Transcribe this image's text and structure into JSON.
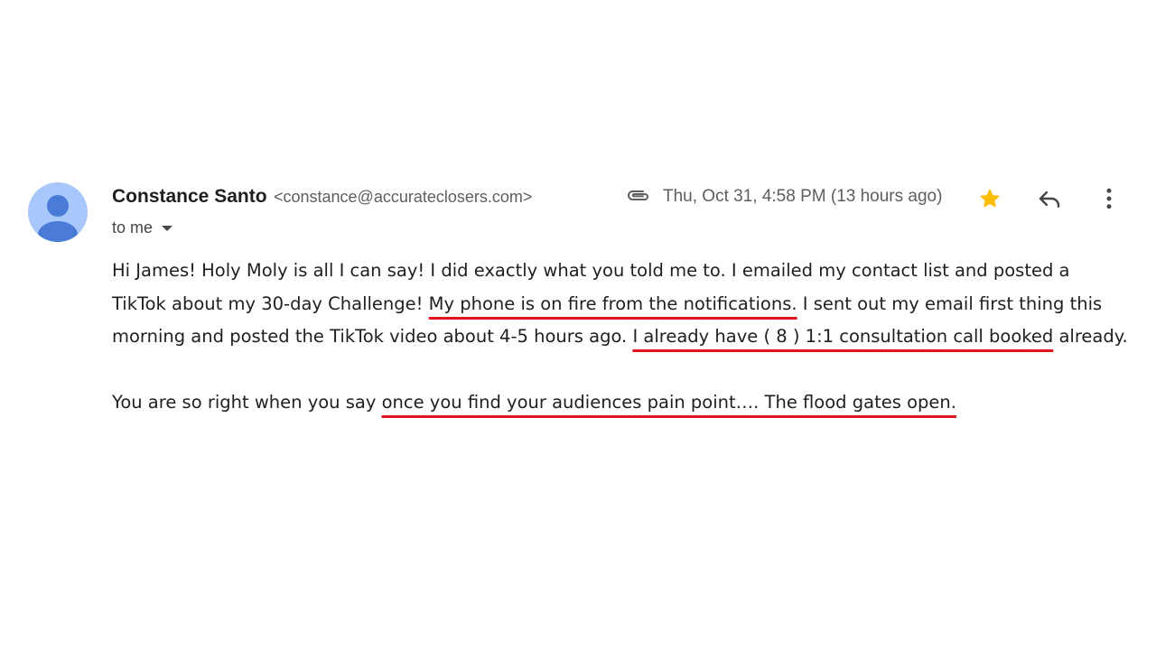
{
  "email": {
    "sender": {
      "name": "Constance Santo",
      "address": "<constance@accurateclosers.com>"
    },
    "recipient_label": "to me",
    "date": "Thu, Oct 31, 4:58 PM (13 hours ago)",
    "has_attachment": true,
    "starred": true,
    "colors": {
      "avatar_bg": "#a8c7fa",
      "avatar_figure": "#4a7bd6",
      "star": "#fbbc04",
      "underline": "#e0141e"
    },
    "icons": {
      "attachment": "paperclip-icon",
      "star": "star-icon",
      "reply": "reply-icon",
      "more": "more-vert-icon",
      "expand": "caret-down-icon"
    },
    "body": {
      "p1_a": "Hi James! Holy Moly is all I can say! I did exactly what you told me to. I emailed my contact list and posted a TikTok about my 30-day Challenge!  ",
      "p1_hl1": "My phone is on fire from the notifications.",
      "p1_b": "  I sent out my email first thing this morning and posted the TikTok video about 4-5 hours ago. ",
      "p1_hl2": "I already have ( 8 ) 1:1 consultation call booked",
      "p1_c": " already.",
      "p2_a": "You are so right when you say ",
      "p2_hl": "once you find your audiences pain point…. The flood gates open."
    }
  }
}
